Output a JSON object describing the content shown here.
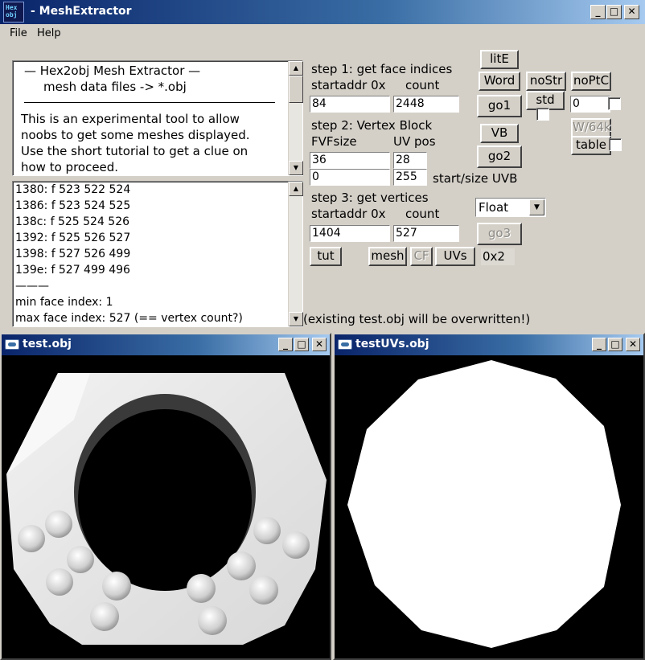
{
  "window": {
    "title": "- MeshExtractor",
    "icon_text": "Hex obj"
  },
  "menu": {
    "file": "File",
    "help": "Help"
  },
  "intro": {
    "lines": [
      "—  Hex2obj Mesh Extractor  —",
      "mesh data files -> *.obj",
      "This is an experimental tool to allow",
      "noobs to get some meshes displayed.",
      "Use the short tutorial to get a clue on",
      "how to proceed."
    ]
  },
  "log": {
    "lines": [
      "1380: f  523 522 524",
      "1386: f  523 524 525",
      "138c: f  525 524 526",
      "1392: f  525 526 527",
      "1398: f  527 526 499",
      "139e: f  527 499 496",
      "———",
      "min face index: 1",
      "max face index: 527 (== vertex count?)"
    ]
  },
  "step1": {
    "title": "step 1: get face indices",
    "addr_label": "startaddr 0x",
    "count_label": "count",
    "addr_value": "84",
    "count_value": "2448"
  },
  "step2": {
    "title": "step 2: Vertex Block",
    "fvf_label": "FVFsize",
    "uvpos_label": "UV pos",
    "fvf_value": "36",
    "uvpos_value": "28",
    "uvb_start": "0",
    "uvb_size": "255",
    "uvb_label": "start/size UVB"
  },
  "step3": {
    "title": "step 3: get vertices",
    "addr_label": "startaddr 0x",
    "count_label": "count",
    "addr_value": "1404",
    "count_value": "527",
    "type_value": "Float"
  },
  "buttons": {
    "lite": "litE",
    "word": "Word",
    "nostr": "noStr",
    "noptc": "noPtC",
    "go1": "go1",
    "std": "std",
    "vb": "VB",
    "w64k": "W/64k",
    "table": "table",
    "go2": "go2",
    "go3": "go3",
    "tut": "tut",
    "mesh": "mesh",
    "cf": "CF",
    "uvs": "UVs"
  },
  "misc": {
    "ptc_value": "0",
    "hex_value": "0x2"
  },
  "status": "(existing test.obj will be overwritten!)",
  "win_test": {
    "title": "test.obj"
  },
  "win_uvs": {
    "title": "testUVs.obj"
  }
}
